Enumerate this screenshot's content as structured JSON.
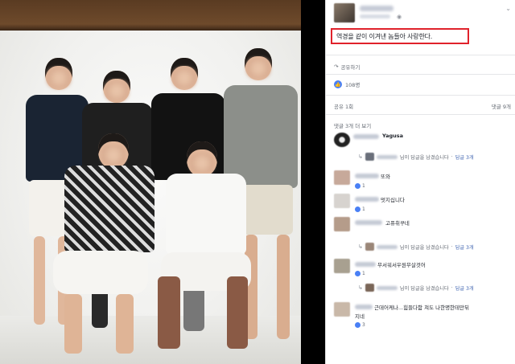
{
  "post": {
    "caption": "역경을 같이 이겨낸 놈들아 사랑한다.",
    "globe_icon": "globe-icon",
    "share_label": "공유하기",
    "like_count": "108명",
    "shares": "공유 1회",
    "comments_count": "댓글 9개",
    "more_comments": "댓글 3개 더 보기"
  },
  "comments": [
    {
      "name": "Yagusa",
      "text": "",
      "reply_text": "님이 답글을 남겼습니다",
      "reply_link": "답글 3개"
    },
    {
      "name": "",
      "text": "또와",
      "likes": "1"
    },
    {
      "name": "",
      "text": "멋지십니다",
      "likes": "1"
    },
    {
      "name": "",
      "text": "고퓨취꾸네",
      "likes": "",
      "reply_text": "님이 답글을 남겼습니다",
      "reply_link": "답글 3개"
    },
    {
      "name": "",
      "text": "무서워서우원무살것어",
      "likes": "1",
      "reply_text": "님이 답글을 남겼습니다",
      "reply_link": "답글 3개"
    },
    {
      "name": "",
      "text": "근데어케나...힘들다함 쳐도 나한명한테만뒤",
      "text2": "지네",
      "likes": "3"
    }
  ]
}
